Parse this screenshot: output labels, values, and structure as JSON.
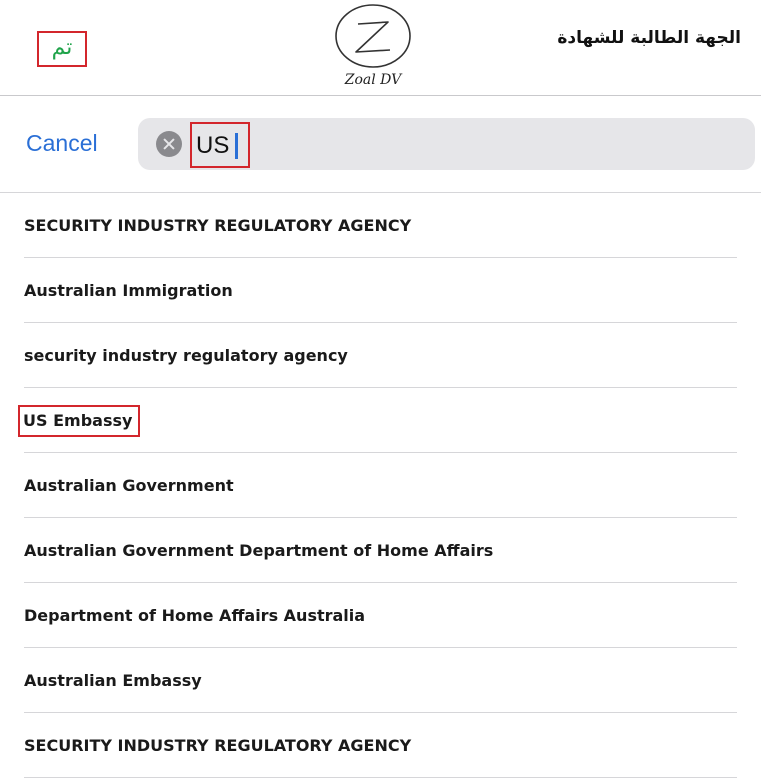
{
  "header": {
    "done_label": "تم",
    "logo_text": "Zoal DV",
    "title": "الجهة الطالبة للشهادة"
  },
  "search": {
    "cancel_label": "Cancel",
    "value": "US",
    "clear_icon": "clear-x-icon"
  },
  "results": [
    "SECURITY INDUSTRY REGULATORY AGENCY",
    "Australian Immigration",
    "security industry regulatory agency",
    "US Embassy",
    "Australian Government",
    "Australian Government Department of Home Affairs",
    "Department of Home Affairs Australia",
    "Australian Embassy",
    "SECURITY INDUSTRY REGULATORY AGENCY"
  ],
  "colors": {
    "accent_blue": "#2a6fd6",
    "done_green": "#1fa34a",
    "highlight_red": "#d3262c"
  }
}
